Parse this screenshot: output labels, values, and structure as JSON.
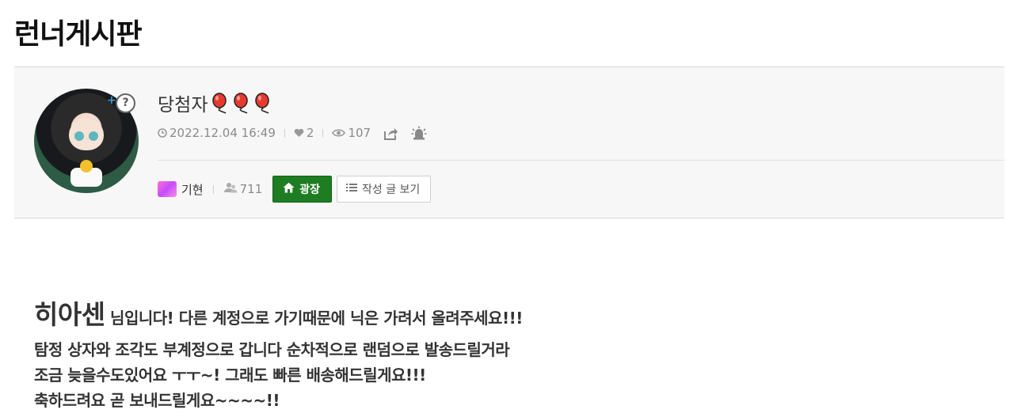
{
  "board": {
    "title": "런너게시판"
  },
  "post": {
    "title": "당첨자",
    "title_emoji_count": 3,
    "date": "2022.12.04 16:49",
    "likes": "2",
    "views": "107"
  },
  "author": {
    "name": "기현",
    "friends": "711",
    "plaza_label": "광장",
    "list_label": "작성 글 보기",
    "help_glyph": "?",
    "plus_glyph": "+"
  },
  "body": {
    "line1_big": "히아센",
    "line1_rest": " 님입니다! 다른 계정으로 가기때문에 닉은 가려서 올려주세요!!!",
    "line2": "탐정 상자와 조각도 부계정으로 갑니다 순차적으로 랜덤으로 발송드릴거라",
    "line3": "조금 늦을수도있어요 ㅜㅜ~! 그래도 빠른 배송해드릴게요!!!",
    "line4": "축하드려요 곧 보내드릴게요~~~~!!"
  },
  "icons": {
    "clock": "clock-icon",
    "heart": "heart-icon",
    "eye": "eye-icon",
    "share": "share-icon",
    "report": "siren-icon",
    "home": "home-icon",
    "list": "list-icon",
    "friends": "friends-icon",
    "balloon": "balloon-icon"
  },
  "colors": {
    "accent_green": "#1e7d22",
    "balloon_red": "#e8392e"
  }
}
